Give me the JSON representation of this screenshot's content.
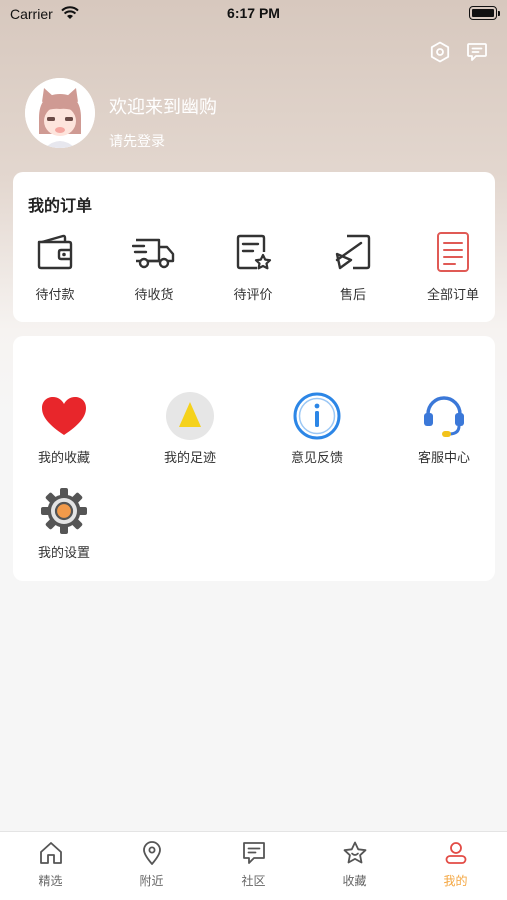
{
  "status_bar": {
    "carrier": "Carrier",
    "time": "6:17 PM"
  },
  "header": {
    "icons": [
      "settings-hex-icon",
      "message-icon"
    ]
  },
  "profile": {
    "welcome": "欢迎来到幽购",
    "login_hint": "请先登录"
  },
  "orders": {
    "title": "我的订单",
    "items": [
      {
        "label": "待付款",
        "icon": "wallet-icon"
      },
      {
        "label": "待收货",
        "icon": "truck-icon"
      },
      {
        "label": "待评价",
        "icon": "review-icon"
      },
      {
        "label": "售后",
        "icon": "after-sale-icon"
      },
      {
        "label": "全部订单",
        "icon": "all-orders-icon"
      }
    ]
  },
  "services": {
    "items": [
      {
        "label": "我的收藏",
        "icon": "heart-icon"
      },
      {
        "label": "我的足迹",
        "icon": "footprint-icon"
      },
      {
        "label": "意见反馈",
        "icon": "info-icon"
      },
      {
        "label": "客服中心",
        "icon": "headset-icon"
      },
      {
        "label": "我的设置",
        "icon": "gear-icon"
      }
    ]
  },
  "tabbar": {
    "items": [
      {
        "label": "精选",
        "icon": "home-icon"
      },
      {
        "label": "附近",
        "icon": "location-icon"
      },
      {
        "label": "社区",
        "icon": "chat-icon"
      },
      {
        "label": "收藏",
        "icon": "star-icon"
      },
      {
        "label": "我的",
        "icon": "user-icon",
        "active": true
      }
    ],
    "active_color": "#f4a640"
  }
}
